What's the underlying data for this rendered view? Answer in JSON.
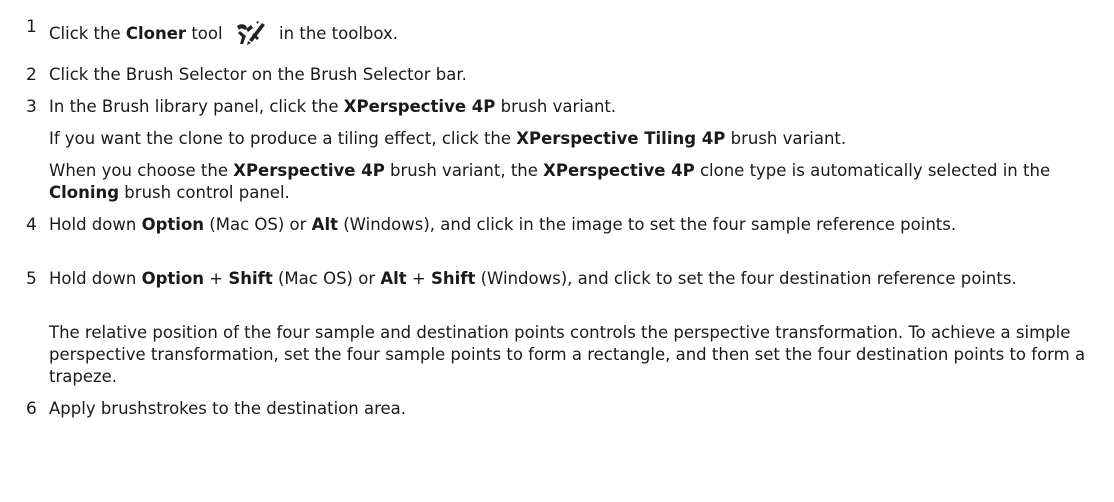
{
  "steps": [
    {
      "number": "1",
      "parts": [
        {
          "t": "Click the "
        },
        {
          "t": "Cloner",
          "b": true
        },
        {
          "t": " tool "
        },
        {
          "icon": "cloner-tool-icon"
        },
        {
          "t": " in the toolbox."
        }
      ],
      "notes": []
    },
    {
      "number": "2",
      "parts": [
        {
          "t": "Click the Brush Selector on the Brush Selector bar."
        }
      ],
      "notes": []
    },
    {
      "number": "3",
      "parts": [
        {
          "t": "In the Brush library panel, click the "
        },
        {
          "t": "XPerspective 4P",
          "b": true
        },
        {
          "t": " brush variant."
        }
      ],
      "notes": [
        [
          {
            "t": "If you want the clone to produce a tiling effect, click the "
          },
          {
            "t": "XPerspective Tiling 4P",
            "b": true
          },
          {
            "t": " brush variant."
          }
        ],
        [
          {
            "t": "When you choose the "
          },
          {
            "t": "XPerspective 4P",
            "b": true
          },
          {
            "t": " brush variant, the "
          },
          {
            "t": "XPerspective 4P",
            "b": true
          },
          {
            "t": " clone type is automatically selected in the "
          },
          {
            "t": "Cloning",
            "b": true
          },
          {
            "t": " brush control panel."
          }
        ]
      ]
    },
    {
      "number": "4",
      "parts": [
        {
          "t": "Hold down "
        },
        {
          "t": "Option",
          "b": true
        },
        {
          "t": " (Mac OS) or "
        },
        {
          "t": "Alt",
          "b": true
        },
        {
          "t": " (Windows), and click in the image to set the four sample reference points."
        }
      ],
      "notes": []
    },
    {
      "number": "5",
      "parts": [
        {
          "t": "Hold down "
        },
        {
          "t": "Option",
          "b": true
        },
        {
          "t": " + "
        },
        {
          "t": "Shift",
          "b": true
        },
        {
          "t": " (Mac OS) or "
        },
        {
          "t": "Alt",
          "b": true
        },
        {
          "t": " + "
        },
        {
          "t": "Shift",
          "b": true
        },
        {
          "t": " (Windows), and click to set the four destination reference points."
        }
      ],
      "notes": [
        [
          {
            "t": "The relative position of the four sample and destination points controls the perspective transformation. To achieve a simple perspective transformation, set the four sample points to form a rectangle, and then set the four destination points to form a trapeze."
          }
        ]
      ]
    },
    {
      "number": "6",
      "parts": [
        {
          "t": "Apply brushstrokes to the destination area."
        }
      ],
      "notes": []
    }
  ]
}
